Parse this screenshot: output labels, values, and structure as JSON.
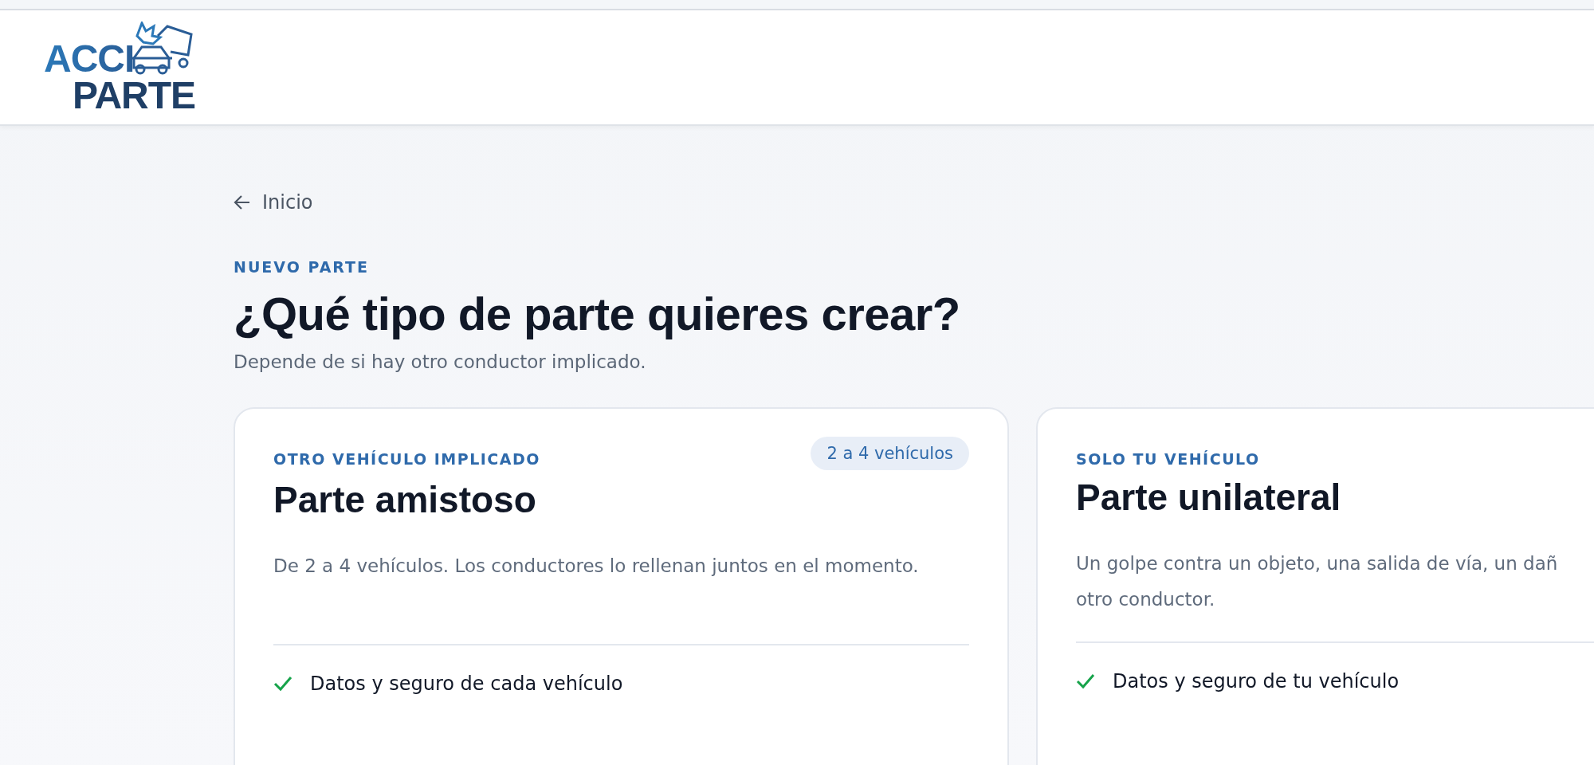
{
  "header": {
    "logo": {
      "line_1": "ACCI",
      "line_2": "PARTE"
    }
  },
  "back_link": {
    "label": "Inicio"
  },
  "eyebrow": "NUEVO PARTE",
  "heading": "¿Qué tipo de parte quieres crear?",
  "subtitle": "Depende de si hay otro conductor implicado.",
  "cards": [
    {
      "eyebrow": "OTRO VEHÍCULO IMPLICADO",
      "badge": "2 a 4 vehículos",
      "title": "Parte amistoso",
      "description_lines": [
        "De 2 a 4 vehículos. Los conductores lo rellenan juntos en el momento."
      ],
      "features": [
        "Datos y seguro de cada vehículo"
      ]
    },
    {
      "eyebrow": "SOLO TU VEHÍCULO",
      "title": "Parte unilateral",
      "description_lines": [
        "Un golpe contra un objeto, una salida de vía, un dañ",
        "otro conductor."
      ],
      "features": [
        "Datos y seguro de tu vehículo"
      ]
    }
  ]
}
